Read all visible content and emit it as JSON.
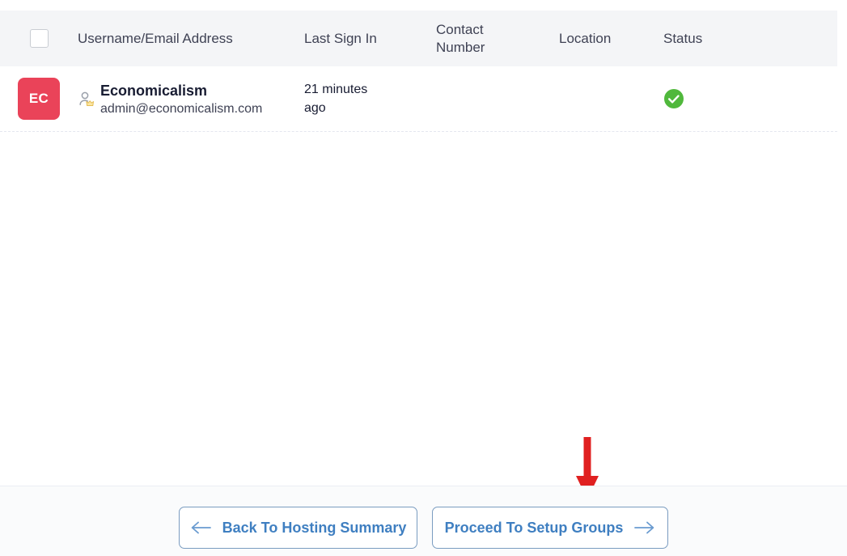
{
  "table": {
    "columns": [
      {
        "key": "checkbox",
        "label": "",
        "icon": "checkbox-icon"
      },
      {
        "key": "username",
        "label": "Username/Email Address"
      },
      {
        "key": "last_sign_in",
        "label": "Last Sign In"
      },
      {
        "key": "contact_number",
        "label": "Contact Number"
      },
      {
        "key": "location",
        "label": "Location"
      },
      {
        "key": "status",
        "label": "Status"
      }
    ],
    "select_all_checked": false,
    "rows": [
      {
        "avatar_initials": "EC",
        "avatar_color": "#ea4359",
        "role_icon": "user-crown-icon",
        "username": "Economicalism",
        "email": "admin@economicalism.com",
        "last_sign_in": "21 minutes ago",
        "contact_number": "",
        "location": "",
        "status_icon": "check-circle-icon",
        "status_color": "#50b83c",
        "selected": false
      }
    ]
  },
  "footer": {
    "back_button": {
      "label": "Back To Hosting Summary",
      "icon": "arrow-left-icon"
    },
    "proceed_button": {
      "label": "Proceed To Setup Groups",
      "icon": "arrow-right-icon"
    }
  },
  "annotation": {
    "arrow_icon": "red-down-arrow-icon",
    "arrow_color": "#e02020",
    "points_to": "Proceed To Setup Groups"
  },
  "colors": {
    "header_bg": "#f4f5f7",
    "footer_bg": "#fafbfc",
    "link_blue": "#3f7fc1",
    "border": "#ebedf3",
    "text_dark": "#181c32",
    "text_muted": "#3f4254"
  }
}
